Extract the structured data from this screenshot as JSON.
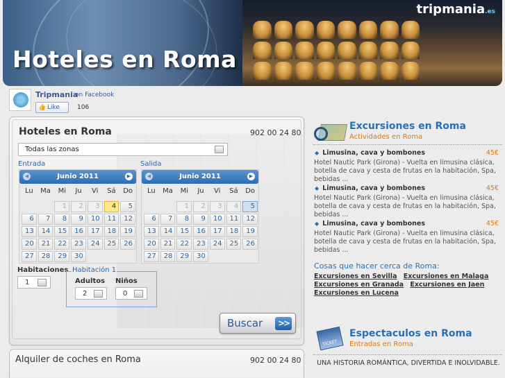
{
  "header": {
    "title": "Hoteles en Roma",
    "brand": "tripmania",
    "brand_suffix": ".es"
  },
  "facebook": {
    "name": "Tripmania",
    "on": "on Facebook",
    "like_label": "Like",
    "like_count": "106"
  },
  "booking": {
    "title": "Hoteles en Roma",
    "phone": "902 00 24 80",
    "zone_value": "Todas las zonas",
    "entrada_label": "Entrada",
    "salida_label": "Salida",
    "calendar_left": {
      "month": "Junio 2011",
      "dows": [
        "Lu",
        "Ma",
        "Mi",
        "Ju",
        "Vi",
        "Sá",
        "Do"
      ],
      "days": [
        "",
        "",
        "1",
        "2",
        "3",
        "4",
        "5",
        "6",
        "7",
        "8",
        "9",
        "10",
        "11",
        "12",
        "13",
        "14",
        "15",
        "16",
        "17",
        "18",
        "19",
        "20",
        "21",
        "22",
        "23",
        "24",
        "25",
        "26",
        "27",
        "28",
        "29",
        "30"
      ],
      "disabled": [
        "1",
        "2",
        "3"
      ],
      "highlight": "4"
    },
    "calendar_right": {
      "month": "Junio 2011",
      "dows": [
        "Lu",
        "Ma",
        "Mi",
        "Ju",
        "Vi",
        "Sá",
        "Do"
      ],
      "days": [
        "",
        "",
        "1",
        "2",
        "3",
        "4",
        "5",
        "6",
        "7",
        "8",
        "9",
        "10",
        "11",
        "12",
        "13",
        "14",
        "15",
        "16",
        "17",
        "18",
        "19",
        "20",
        "21",
        "22",
        "23",
        "24",
        "25",
        "26",
        "27",
        "28",
        "29",
        "30"
      ],
      "disabled": [
        "1",
        "2",
        "3",
        "4"
      ],
      "highlight": "5"
    },
    "habitaciones_label": "Habitaciones",
    "habitaciones_value": "1",
    "room_title": "Habitación 1",
    "adultos_label": "Adultos",
    "adultos_value": "2",
    "ninos_label": "Niños",
    "ninos_value": "0",
    "search_label": "Buscar",
    "search_arrow": ">>"
  },
  "car_rental": {
    "title": "Alquiler de coches en Roma",
    "phone": "902 00 24 80"
  },
  "excursiones": {
    "title": "Excursiones en Roma",
    "subtitle": "Actividades en Roma",
    "items": [
      {
        "title": "Limusina, cava y bombones",
        "price": "45€",
        "desc": "Hotel Nautic Park (Girona) - Vuelta en limusina clásica, botella de cava y cesta de frutas en la habitación, Spa, bebidas ..."
      },
      {
        "title": "Limusina, cava y bombones",
        "price": "45€",
        "desc": "Hotel Nautic Park (Girona) - Vuelta en limusina clásica, botella de cava y cesta de frutas en la habitación, Spa, bebidas ..."
      },
      {
        "title": "Limusina, cava y bombones",
        "price": "45€",
        "desc": "Hotel Nautic Park (Girona) - Vuelta en limusina clásica, botella de cava y cesta de frutas en la habitación, Spa, bebidas ..."
      }
    ],
    "cosas_label": "Cosas que hacer cerca de Roma:",
    "links": [
      "Excursiones en Sevilla",
      "Excursiones en Malaga",
      "Excursiones en Granada",
      "Excursiones en Jaen",
      "Excursiones en Lucena"
    ]
  },
  "espectaculos": {
    "title": "Espectaculos en Roma",
    "subtitle": "Entradas en Roma",
    "desc": "UNA HISTORIA ROMÁNTICA, DIVERTIDA E INOLVIDABLE."
  }
}
